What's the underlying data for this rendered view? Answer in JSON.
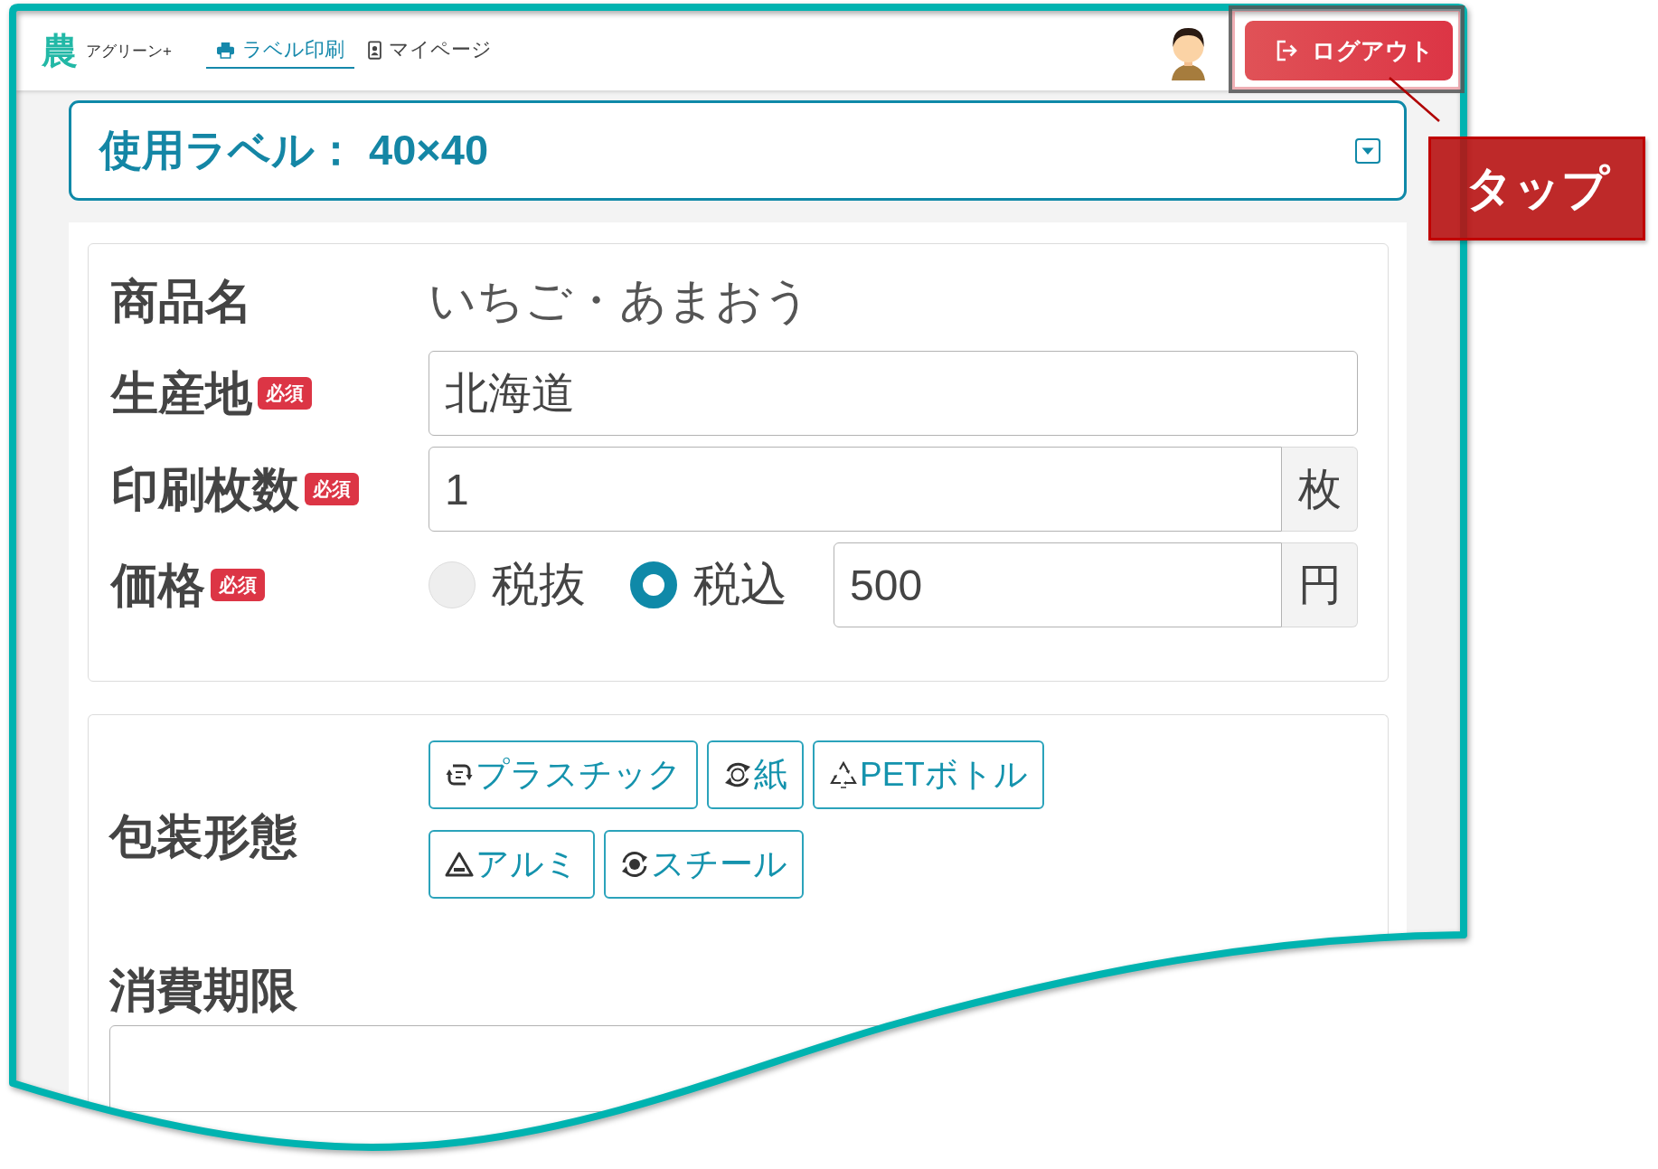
{
  "header": {
    "logo_mark": "農",
    "logo_text": "アグリーン+",
    "tabs": [
      {
        "label": "ラベル印刷",
        "selected": true
      },
      {
        "label": "マイページ",
        "selected": false
      }
    ],
    "logout_button": "ログアウト"
  },
  "label_select": {
    "value": "使用ラベル： 40×40"
  },
  "form": {
    "fields": [
      {
        "kind": "static",
        "label": "商品名",
        "value": "いちご・あまおう"
      },
      {
        "kind": "text",
        "label": "生産地",
        "badge": "必須",
        "value": "北海道"
      },
      {
        "kind": "unit",
        "label": "印刷枚数",
        "badge": "必須",
        "value": "1",
        "unit": "枚"
      },
      {
        "kind": "price",
        "label": "価格",
        "badge": "必須",
        "tax_options": [
          {
            "label": "税抜",
            "selected": false
          },
          {
            "label": "税込",
            "selected": true
          }
        ],
        "value": "500",
        "unit": "円"
      }
    ]
  },
  "packaging": {
    "label": "包装形態",
    "options": [
      {
        "label": "プラスチック",
        "selected": false
      },
      {
        "label": "紙",
        "selected": false
      },
      {
        "label": "PETボトル",
        "selected": false
      },
      {
        "label": "アルミ",
        "selected": false
      },
      {
        "label": "スチール",
        "selected": false
      }
    ]
  },
  "expiry": {
    "label": "消費期限"
  },
  "annotation": {
    "callout": "タップ"
  }
}
